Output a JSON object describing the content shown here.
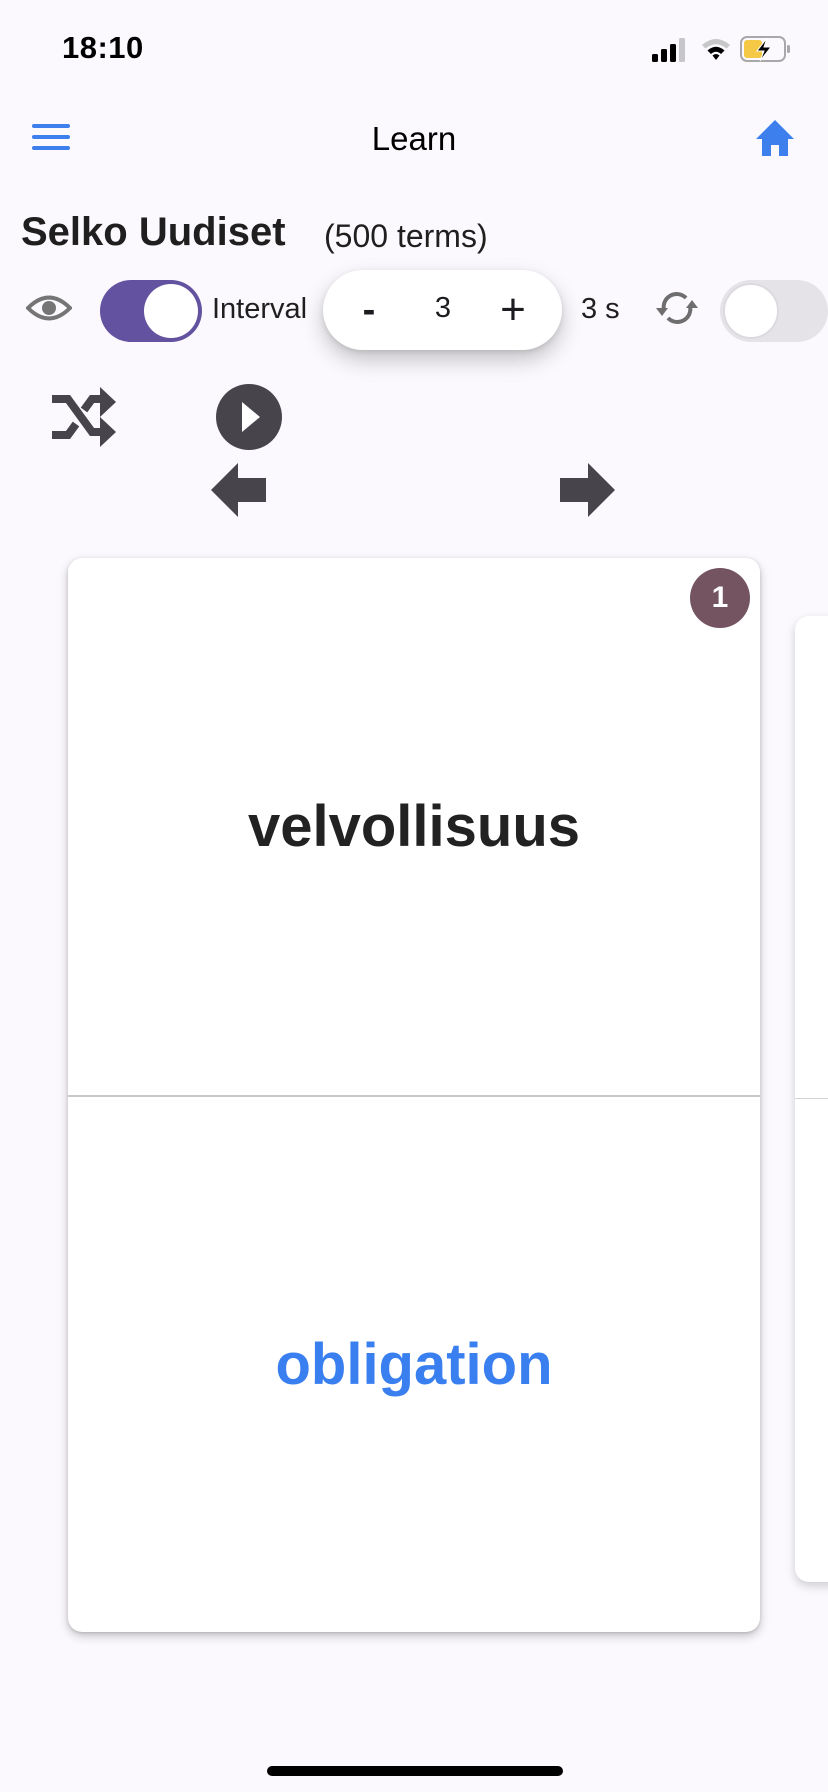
{
  "status_bar": {
    "time": "18:10",
    "icons": [
      "cellular-signal-icon",
      "wifi-icon",
      "battery-charging-icon"
    ]
  },
  "header": {
    "title": "Learn",
    "left_icon": "menu-icon",
    "right_icon": "home-icon",
    "accent_color": "#3d7fed"
  },
  "deck": {
    "title": "Selko Uudiset",
    "term_count": "(500 terms)"
  },
  "controls": {
    "show_answer_icon": "eye-icon",
    "interval_toggle": {
      "label": "Interval",
      "on": true,
      "color": "#6352a0"
    },
    "stepper": {
      "minus_label": "-",
      "value": "3",
      "plus_label": "+"
    },
    "interval_readout": "3 s",
    "repeat_icon": "repeat-icon",
    "repeat_toggle": {
      "on": false
    }
  },
  "playback": {
    "shuffle_icon": "shuffle-icon",
    "play_icon": "play-icon",
    "prev_icon": "arrow-left-icon",
    "next_icon": "arrow-right-icon"
  },
  "card": {
    "index_badge": "1",
    "front": "velvollisuus",
    "back": "obligation",
    "back_color": "#3a7ff0",
    "badge_color": "#735460"
  }
}
